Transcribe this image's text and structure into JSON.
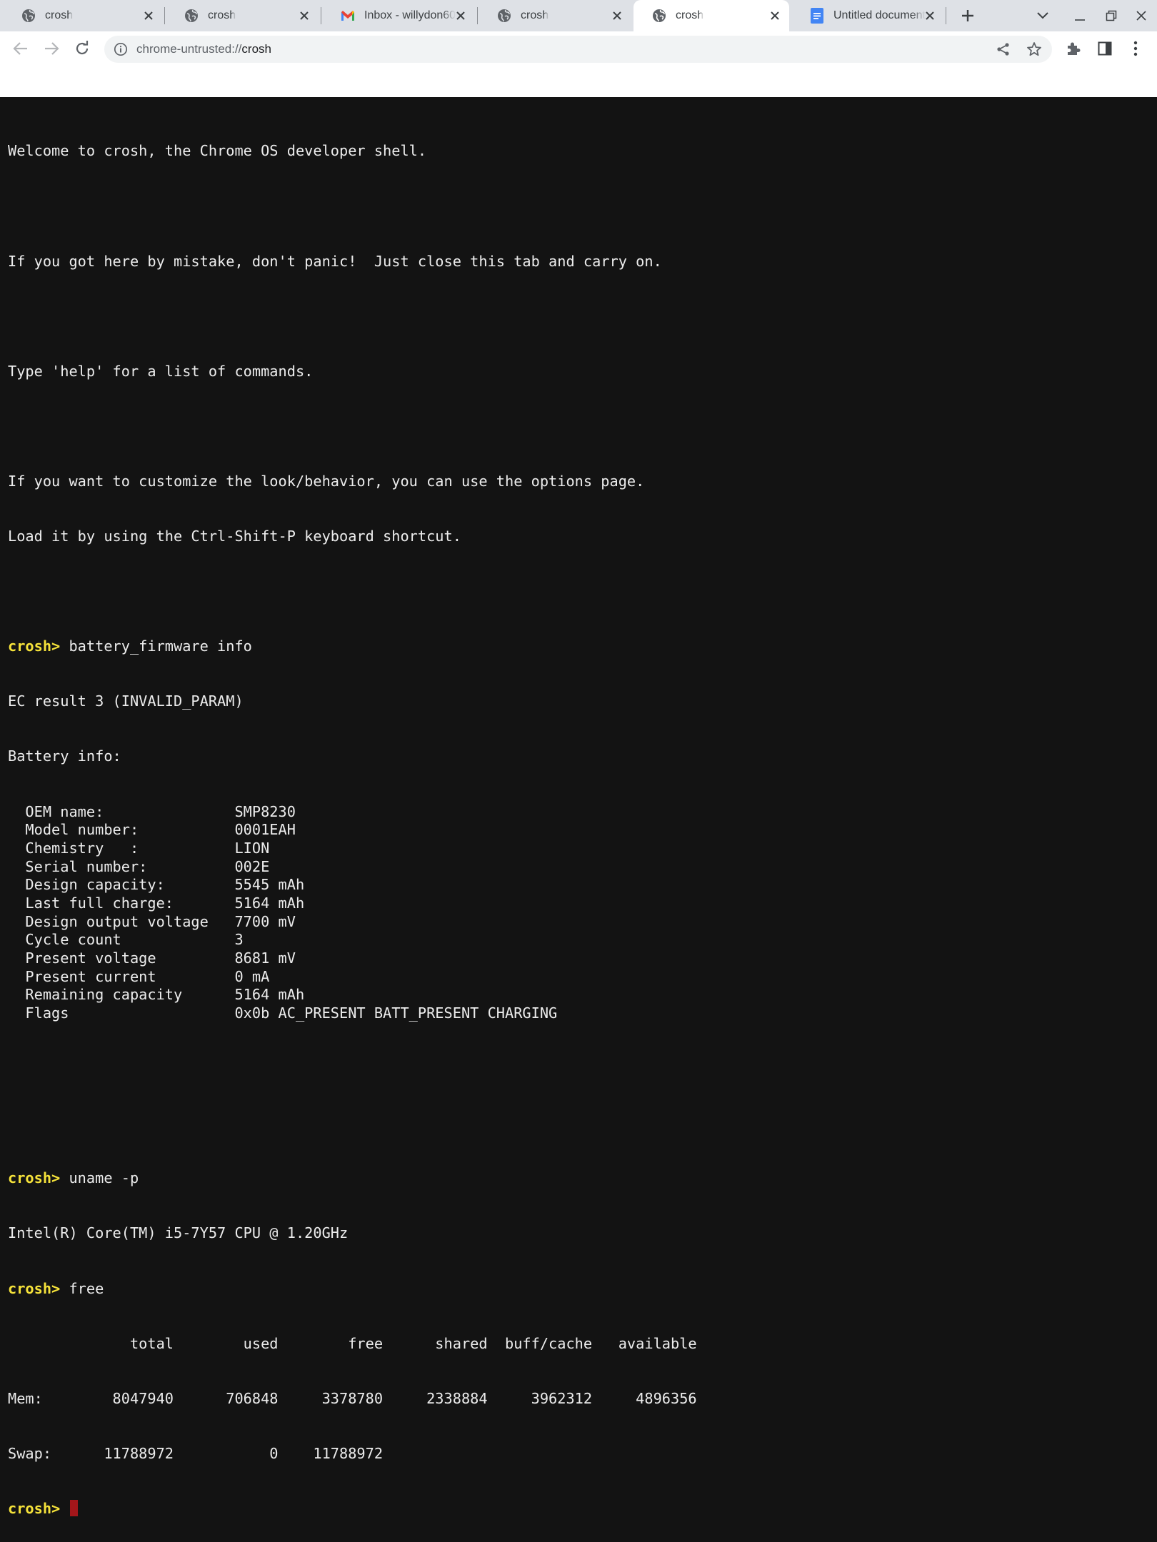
{
  "tabs": [
    {
      "title": "crosh",
      "icon": "globe-icon",
      "active": false
    },
    {
      "title": "crosh",
      "icon": "globe-icon",
      "active": false
    },
    {
      "title": "Inbox - willydon60",
      "icon": "gmail-icon",
      "active": false
    },
    {
      "title": "crosh",
      "icon": "globe-icon",
      "active": false
    },
    {
      "title": "crosh",
      "icon": "globe-icon",
      "active": true
    },
    {
      "title": "Untitled document",
      "icon": "docs-icon",
      "active": false
    }
  ],
  "address_bar": {
    "scheme": "chrome-untrusted://",
    "host": "crosh"
  },
  "terminal": {
    "prompt": "crosh>",
    "welcome": "Welcome to crosh, the Chrome OS developer shell.",
    "mistake": "If you got here by mistake, don't panic!  Just close this tab and carry on.",
    "help": "Type 'help' for a list of commands.",
    "customize_1": "If you want to customize the look/behavior, you can use the options page.",
    "customize_2": "Load it by using the Ctrl-Shift-P keyboard shortcut.",
    "cmd_battery": " battery_firmware info",
    "ec_result": "EC result 3 (INVALID_PARAM)",
    "battery_header": "Battery info:",
    "battery_rows": [
      {
        "label": "  OEM name:",
        "value": "SMP8230"
      },
      {
        "label": "  Model number:",
        "value": "0001EAH"
      },
      {
        "label": "  Chemistry   :",
        "value": "LION"
      },
      {
        "label": "  Serial number:",
        "value": "002E"
      },
      {
        "label": "  Design capacity:",
        "value": "5545 mAh"
      },
      {
        "label": "  Last full charge:",
        "value": "5164 mAh"
      },
      {
        "label": "  Design output voltage",
        "value": "7700 mV"
      },
      {
        "label": "  Cycle count",
        "value": "3"
      },
      {
        "label": "  Present voltage",
        "value": "8681 mV"
      },
      {
        "label": "  Present current",
        "value": "0 mA"
      },
      {
        "label": "  Remaining capacity",
        "value": "5164 mAh"
      },
      {
        "label": "  Flags",
        "value": "0x0b AC_PRESENT BATT_PRESENT CHARGING"
      }
    ],
    "cmd_uname": " uname -p",
    "cpu": "Intel(R) Core(TM) i5-7Y57 CPU @ 1.20GHz",
    "cmd_free": " free",
    "free_header": "              total        used        free      shared  buff/cache   available",
    "free_mem": "Mem:        8047940      706848     3378780     2338884     3962312     4896356",
    "free_swap": "Swap:      11788972           0    11788972"
  },
  "colors": {
    "terminal_bg": "#131313",
    "terminal_fg": "#ececec",
    "prompt": "#f5e23a",
    "cursor": "#a3161a",
    "tabstrip_bg": "#dee1e6"
  }
}
